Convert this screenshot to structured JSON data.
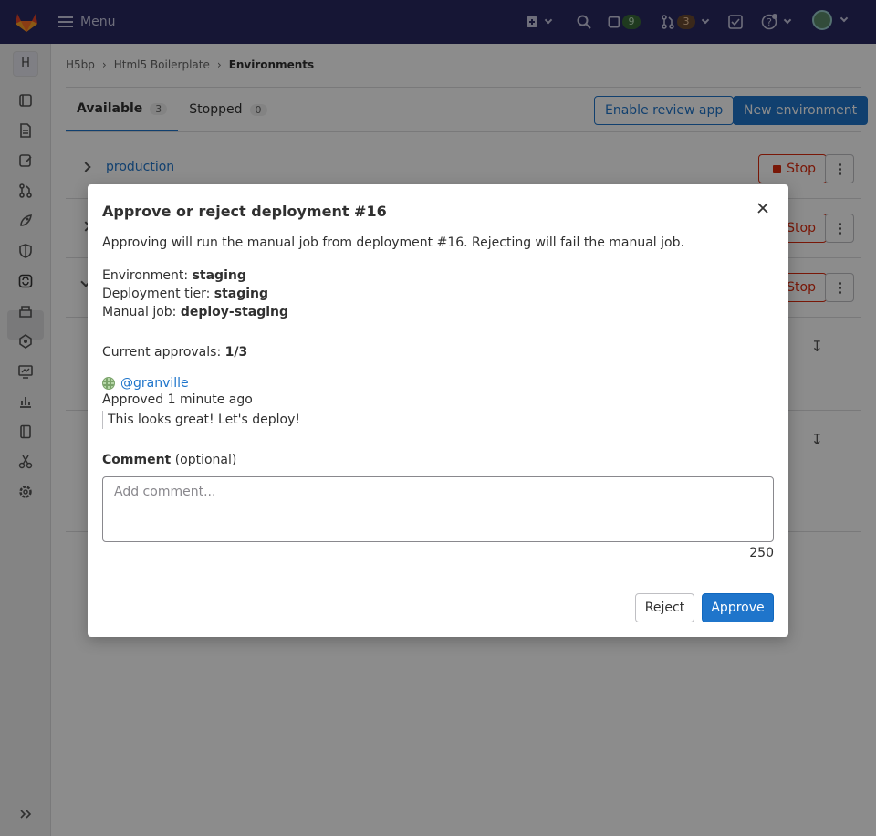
{
  "topbar": {
    "menu_label": "Menu",
    "issues_count": "9",
    "merge_requests_count": "3"
  },
  "sidebar": {
    "project_initial": "H"
  },
  "breadcrumb": {
    "items": [
      "H5bp",
      "Html5 Boilerplate",
      "Environments"
    ]
  },
  "tabs": [
    {
      "label": "Available",
      "count": "3"
    },
    {
      "label": "Stopped",
      "count": "0"
    }
  ],
  "header_buttons": {
    "review_app": "Enable review app",
    "new_environment": "New environment"
  },
  "environments": [
    {
      "name": "production",
      "stop_label": "Stop"
    },
    {
      "stop_label": "Stop"
    },
    {
      "stop_label": "Stop"
    }
  ],
  "modal": {
    "title": "Approve or reject deployment #16",
    "description": "Approving will run the manual job from deployment #16. Rejecting will fail the manual job.",
    "environment_label": "Environment:",
    "environment_value": "staging",
    "tier_label": "Deployment tier:",
    "tier_value": "staging",
    "job_label": "Manual job:",
    "job_value": "deploy-staging",
    "approvals_label": "Current approvals:",
    "approvals_value": "1/3",
    "approver_handle": "@granville",
    "approved_time": "Approved 1 minute ago",
    "approval_comment": "This looks great! Let's deploy!",
    "comment_label": "Comment",
    "comment_optional": "(optional)",
    "comment_placeholder": "Add comment...",
    "char_count": "250",
    "reject_label": "Reject",
    "approve_label": "Approve"
  },
  "colors": {
    "topbar": "#292961",
    "primary": "#1f75cb",
    "danger": "#dd2b0e"
  }
}
